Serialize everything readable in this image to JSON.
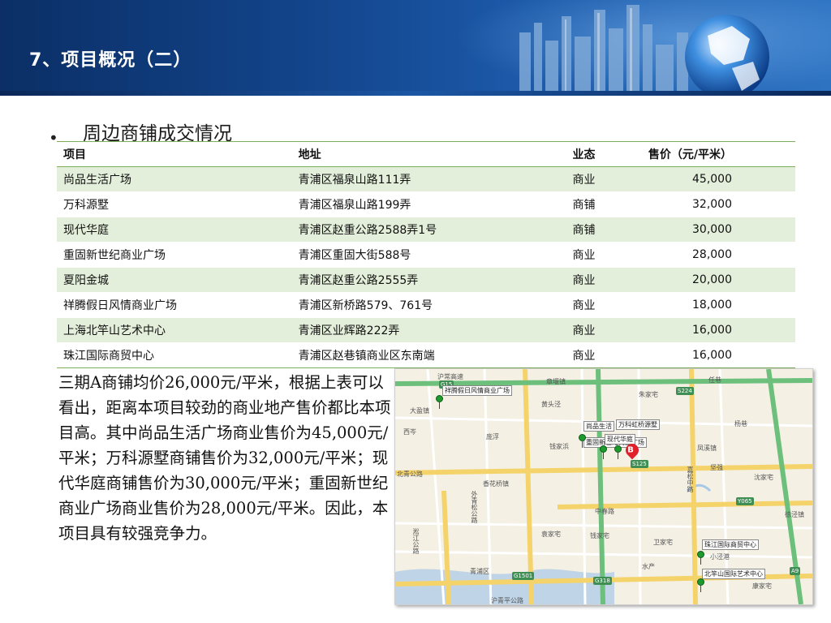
{
  "slide": {
    "title": "7、项目概况（二）",
    "bullet": "周边商铺成交情况"
  },
  "table": {
    "headers": [
      "项目",
      "地址",
      "业态",
      "售价（元/平米）"
    ],
    "rows": [
      [
        "尚品生活广场",
        "青浦区福泉山路111弄",
        "商业",
        "45,000"
      ],
      [
        "万科源墅",
        "青浦区福泉山路199弄",
        "商铺",
        "32,000"
      ],
      [
        "现代华庭",
        "青浦区赵重公路2588弄1号",
        "商铺",
        "30,000"
      ],
      [
        "重固新世纪商业广场",
        "青浦区重固大街588号",
        "商业",
        "28,000"
      ],
      [
        "夏阳金城",
        "青浦区赵重公路2555弄",
        "商业",
        "20,000"
      ],
      [
        "祥腾假日风情商业广场",
        "青浦区新桥路579、761号",
        "商业",
        "18,000"
      ],
      [
        "上海北竿山艺术中心",
        "青浦区业辉路222弄",
        "商业",
        "16,000"
      ],
      [
        "珠江国际商贸中心",
        "青浦区赵巷镇商业区东南端",
        "商业",
        "16,000"
      ]
    ]
  },
  "paragraph": "三期A商铺均价26,000元/平米，根据上表可以看出，距离本项目较劲的商业地产售价都比本项目高。其中尚品生活广场商业售价为45,000元/平米；万科源墅商铺售价为32,000元/平米；现代华庭商铺售价为30,000元/平米；重固新世纪商业广场商业售价为28,000元/平米。因此，本项目具有较强竞争力。",
  "map": {
    "place_labels": {
      "hucang": "沪常高速",
      "zhangyan": "章堰镇",
      "daying": "大盈镇",
      "xicen": "西岑",
      "lianqiao": "庞浮",
      "huangtou": "黄头泾",
      "zhujia": "朱家宅",
      "renxiang": "任巷",
      "yangxiang": "杨巷",
      "qianjia": "钱家浜",
      "xianghua": "香花桥镇",
      "beiqing": "北青公路",
      "fengxi": "凤溪镇",
      "jianxi": "坚强",
      "shenjia": "沈家宅",
      "xuj": "徐泾镇",
      "qingpu": "青浦区",
      "huqing": "沪青平公路",
      "xiaojing": "小泾港",
      "kangjia": "康家宅",
      "jiali": "嘉松中路",
      "zhongchun": "中春路",
      "waiqing": "外青松公路",
      "tongjiang": "淞江公路",
      "jingjiang": "钱家宅",
      "yuanjia": "袁家宅",
      "weijia": "卫家宅",
      "shuichan": "水产"
    },
    "shields": [
      "G15",
      "S224",
      "S125",
      "G1501",
      "G318",
      "A9",
      "Y065"
    ],
    "poi_labels": {
      "xiangteng": "祥腾假日风情商业广场",
      "shangpin": "尚品生活",
      "wanke": "万科虹桥源墅",
      "chonggu": "重固新世纪商业广场",
      "xiandai": "现代华庭",
      "zhujiang": "珠江国际商贸中心",
      "beigan": "北竿山国际艺术中心"
    },
    "project_marker": "B"
  },
  "colors": {
    "header_bg": "#124389",
    "table_stripe": "#e3efda",
    "table_rule": "#7fae5b",
    "marker_red": "#e0202a",
    "pin_green": "#1d9a2e"
  }
}
